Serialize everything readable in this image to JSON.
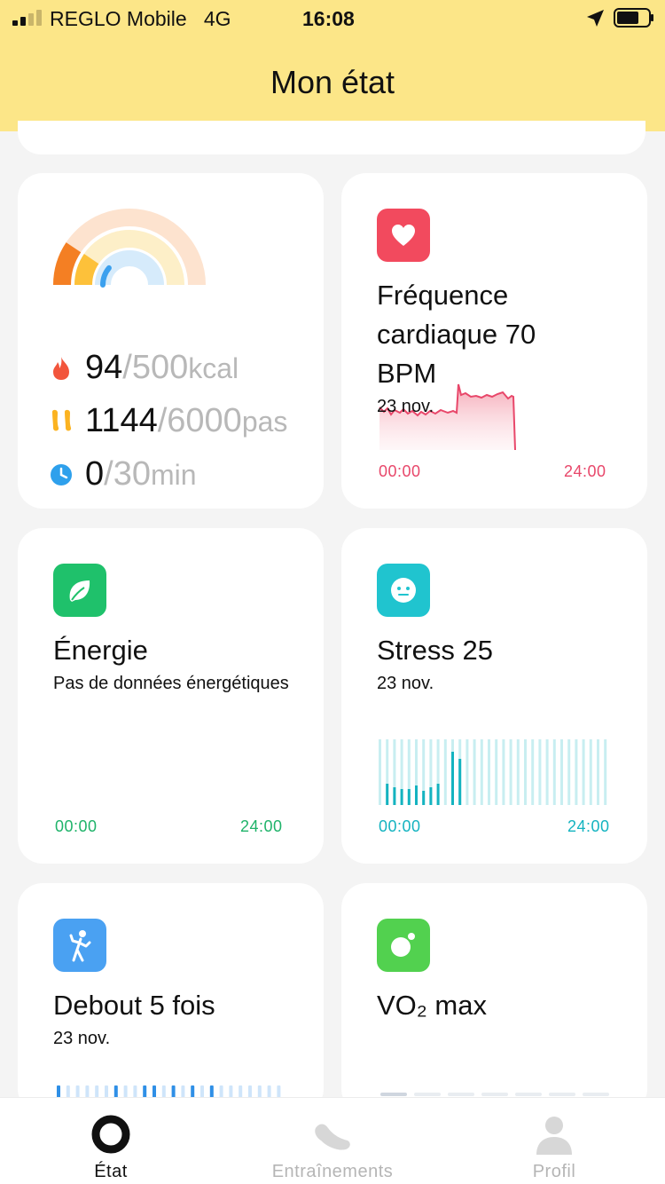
{
  "status_bar": {
    "carrier": "REGLO Mobile",
    "network": "4G",
    "time": "16:08"
  },
  "header": {
    "title": "Mon état"
  },
  "activity": {
    "calories": {
      "value": "94",
      "goal": "/500",
      "unit": "kcal"
    },
    "steps": {
      "value": "1144",
      "goal": "/6000",
      "unit": "pas"
    },
    "minutes": {
      "value": "0",
      "goal": "/30",
      "unit": "min"
    },
    "ring_progress": {
      "calories": 0.188,
      "steps": 0.191,
      "minutes": 0.0
    }
  },
  "heart_rate": {
    "title": "Fréquence cardiaque 70 BPM",
    "title_line1": "Fréquence",
    "title_line2": "cardiaque 70",
    "title_line3": "BPM",
    "date": "23 nov.",
    "axis_start": "00:00",
    "axis_end": "24:00",
    "color": "#e8476a"
  },
  "energy": {
    "title": "Énergie",
    "subtitle": "Pas de données énergétiques",
    "axis_start": "00:00",
    "axis_end": "24:00",
    "color": "#1fc16b"
  },
  "stress": {
    "title": "Stress 25",
    "date": "23 nov.",
    "axis_start": "00:00",
    "axis_end": "24:00",
    "color": "#14b3c0"
  },
  "standing": {
    "title": "Debout 5 fois",
    "date": "23 nov.",
    "color": "#4aa1f2"
  },
  "vo2": {
    "title": "VO₂ max",
    "color": "#52d14f"
  },
  "tabs": [
    {
      "label": "État",
      "icon": "ring-icon",
      "active": true
    },
    {
      "label": "Entraînements",
      "icon": "shoe-icon",
      "active": false
    },
    {
      "label": "Profil",
      "icon": "person-icon",
      "active": false
    }
  ]
}
